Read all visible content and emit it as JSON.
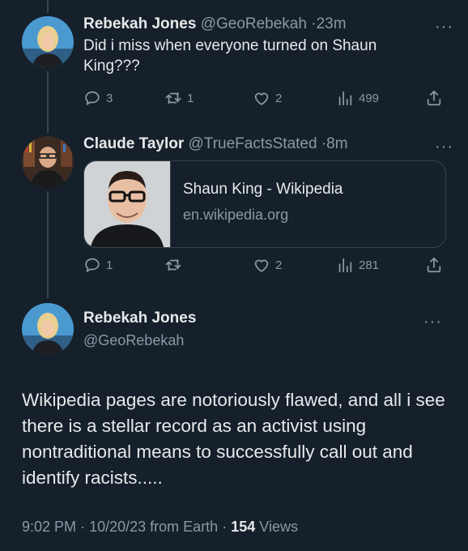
{
  "colors": {
    "background": "#15202b",
    "text": "#e7e9ea",
    "muted": "#8b98a5",
    "border": "#38444d"
  },
  "tweet1": {
    "name": "Rebekah Jones",
    "handle": "@GeoRebekah",
    "time": "23m",
    "text": "Did i miss when everyone turned on Shaun King???",
    "replies": "3",
    "retweets": "1",
    "likes": "2",
    "views": "499"
  },
  "tweet2": {
    "name": "Claude Taylor",
    "handle": "@TrueFactsStated",
    "time": "8m",
    "card": {
      "title": "Shaun King - Wikipedia",
      "domain": "en.wikipedia.org"
    },
    "replies": "1",
    "retweets": "",
    "likes": "2",
    "views": "281"
  },
  "main_tweet": {
    "name": "Rebekah Jones",
    "handle": "@GeoRebekah",
    "text": "Wikipedia pages are notoriously flawed, and all i see there is a stellar record as an activist using nontraditional means to successfully call out and identify racists.....",
    "time": "9:02 PM",
    "date": "10/20/23",
    "source": "from Earth",
    "views_count": "154",
    "views_label": "Views"
  },
  "icons": [
    "reply-icon",
    "retweet-icon",
    "like-icon",
    "views-icon",
    "share-icon",
    "more-icon"
  ]
}
